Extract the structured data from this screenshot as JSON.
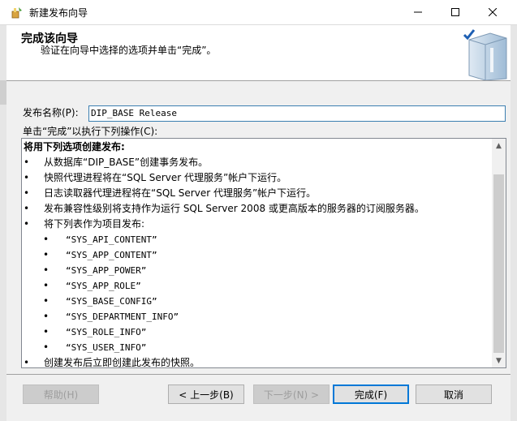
{
  "window": {
    "title": "新建发布向导",
    "min_icon": "minimize-icon",
    "max_icon": "maximize-icon",
    "close_icon": "close-icon"
  },
  "header": {
    "title": "完成该向导",
    "subtitle": "验证在向导中选择的选项并单击“完成”。"
  },
  "form": {
    "publication_name_label": "发布名称(P):",
    "publication_name_value": "DIP_BASE Release",
    "instructions_label": "单击“完成”以执行下列操作(C):"
  },
  "summary": {
    "heading": "将用下列选项创建发布:",
    "bullet": "•",
    "items": [
      "从数据库“DIP_BASE”创建事务发布。",
      "快照代理进程将在“SQL Server 代理服务”帐户下运行。",
      "日志读取器代理进程将在“SQL Server 代理服务”帐户下运行。",
      "发布兼容性级别将支持作为运行 SQL Server 2008 或更高版本的服务器的订阅服务器。",
      "将下列表作为项目发布:"
    ],
    "articles": [
      "“SYS_API_CONTENT”",
      "“SYS_APP_CONTENT”",
      "“SYS_APP_POWER”",
      "“SYS_APP_ROLE”",
      "“SYS_BASE_CONFIG”",
      "“SYS_DEPARTMENT_INFO”",
      "“SYS_ROLE_INFO”",
      "“SYS_USER_INFO”"
    ],
    "final_item": "创建发布后立即创建此发布的快照。"
  },
  "buttons": {
    "help": "帮助(H)",
    "back": "< 上一步(B)",
    "next": "下一步(N) >",
    "finish": "完成(F)",
    "cancel": "取消"
  },
  "colors": {
    "accent": "#0078d7",
    "input_border": "#3c7fb1"
  }
}
